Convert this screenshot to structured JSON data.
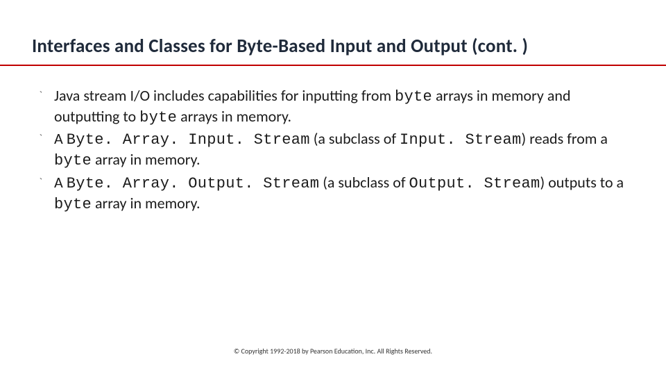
{
  "title": "Interfaces and Classes for Byte-Based Input and Output (cont. )",
  "bullets": [
    {
      "segments": [
        {
          "text": "Java stream I/O includes capabilities for inputting from ",
          "mono": false
        },
        {
          "text": "byte",
          "mono": true
        },
        {
          "text": " arrays in memory and outputting to ",
          "mono": false
        },
        {
          "text": "byte",
          "mono": true
        },
        {
          "text": " arrays in memory.",
          "mono": false
        }
      ]
    },
    {
      "segments": [
        {
          "text": "A ",
          "mono": false
        },
        {
          "text": "Byte. Array. Input. Stream",
          "mono": true
        },
        {
          "text": " (a subclass of ",
          "mono": false
        },
        {
          "text": "Input. Stream",
          "mono": true
        },
        {
          "text": ") reads from a ",
          "mono": false
        },
        {
          "text": "byte",
          "mono": true
        },
        {
          "text": " array in memory.",
          "mono": false
        }
      ]
    },
    {
      "segments": [
        {
          "text": "A ",
          "mono": false
        },
        {
          "text": "Byte. Array. Output. Stream",
          "mono": true
        },
        {
          "text": " (a subclass of ",
          "mono": false
        },
        {
          "text": "Output. Stream",
          "mono": true
        },
        {
          "text": ") outputs to a ",
          "mono": false
        },
        {
          "text": "byte",
          "mono": true
        },
        {
          "text": " array in memory.",
          "mono": false
        }
      ]
    }
  ],
  "footer": "© Copyright 1992-2018 by Pearson Education, Inc. All Rights Reserved.",
  "bullet_marker": "֙"
}
